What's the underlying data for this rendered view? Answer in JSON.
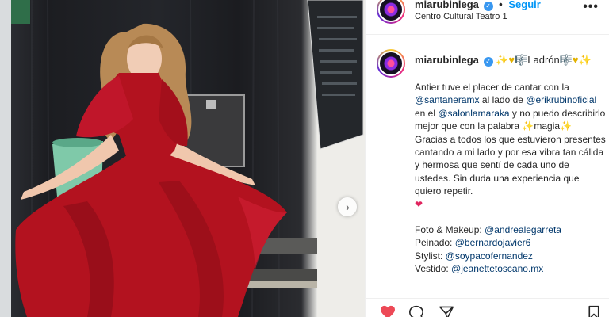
{
  "post": {
    "username": "miarubinlega",
    "verified_mark": "✓",
    "separator": "•",
    "follow_label": "Seguir",
    "location": "Centro Cultural Teatro 1",
    "more_label": "•••"
  },
  "caption": {
    "username": "miarubinlega",
    "title_prefix": "✨♥🎼",
    "title_word": "Ladrón",
    "title_suffix": "🎼♥✨",
    "text_1": "Antier tuve el placer de cantar con la",
    "mention_1": "@santaneramx",
    "text_2": " al lado de",
    "mention_2": "@erikrubinoficial",
    "text_3": " en el ",
    "mention_3": "@salonlamaraka",
    "text_4": " y no puedo describirlo mejor que con la palabra ",
    "spark_1": "✨",
    "text_5": "magia",
    "spark_2": "✨",
    "text_6": " Gracias a todos los que estuvieron presentes cantando a mi lado y por esa vibra tan cálida y hermosa que sentí de cada uno de ustedes. Sin duda una experiencia que quiero repetir.",
    "heart": "❤",
    "credits": [
      {
        "label": "Foto & Makeup: ",
        "mention": "@andrealegarreta"
      },
      {
        "label": "Peinado: ",
        "mention": "@bernardojavier6"
      },
      {
        "label": "Stylist: ",
        "mention": "@soypacofernandez"
      },
      {
        "label": "Vestido: ",
        "mention": "@jeanettetoscano.mx"
      }
    ]
  },
  "carousel": {
    "next_label": "›"
  },
  "icons": [
    "heart-icon",
    "comment-icon",
    "share-icon",
    "bookmark-icon",
    "next-arrow-icon",
    "more-icon",
    "verified-icon"
  ],
  "colors": {
    "accent": "#0095f6",
    "mention": "#00376b",
    "like": "#ed4956",
    "dress": "#b3121f"
  }
}
